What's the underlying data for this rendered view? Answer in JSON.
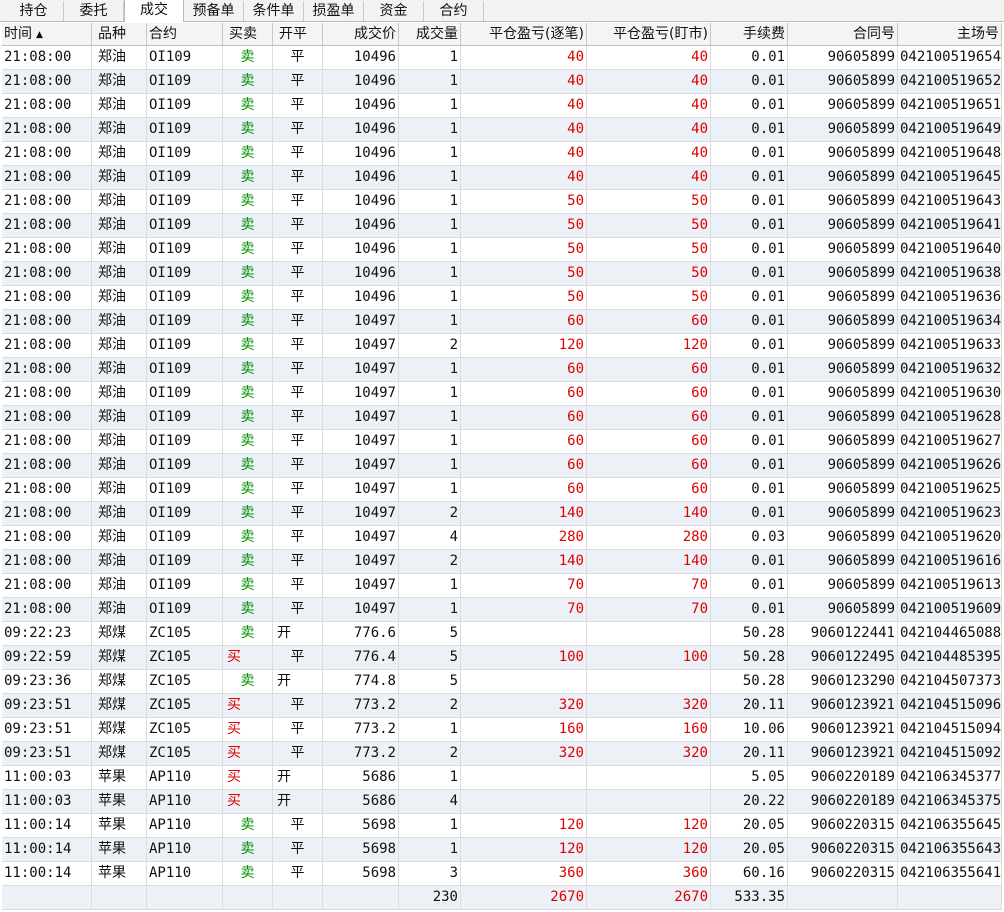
{
  "tabs": [
    "持仓",
    "委托",
    "成交",
    "预备单",
    "条件单",
    "损盈单",
    "资金",
    "合约"
  ],
  "active_tab": 2,
  "columns": {
    "time": "时间",
    "product": "品种",
    "contract": "合约",
    "side": "买卖",
    "openclose": "开平",
    "price": "成交价",
    "qty": "成交量",
    "pnl_trade": "平仓盈亏(逐笔)",
    "pnl_mtm": "平仓盈亏(盯市)",
    "fee": "手续费",
    "contract_no": "合同号",
    "exchange_no": "主场号"
  },
  "sort_icon": "sort-ascending-icon",
  "rows": [
    {
      "time": "21:08:00",
      "product": "郑油",
      "contract": "OI109",
      "side": "卖",
      "oc": "平",
      "price": "10496",
      "qty": "1",
      "pnl1": "40",
      "pnl2": "40",
      "fee": "0.01",
      "cno": "90605899",
      "exno": "042100519654"
    },
    {
      "time": "21:08:00",
      "product": "郑油",
      "contract": "OI109",
      "side": "卖",
      "oc": "平",
      "price": "10496",
      "qty": "1",
      "pnl1": "40",
      "pnl2": "40",
      "fee": "0.01",
      "cno": "90605899",
      "exno": "042100519652"
    },
    {
      "time": "21:08:00",
      "product": "郑油",
      "contract": "OI109",
      "side": "卖",
      "oc": "平",
      "price": "10496",
      "qty": "1",
      "pnl1": "40",
      "pnl2": "40",
      "fee": "0.01",
      "cno": "90605899",
      "exno": "042100519651"
    },
    {
      "time": "21:08:00",
      "product": "郑油",
      "contract": "OI109",
      "side": "卖",
      "oc": "平",
      "price": "10496",
      "qty": "1",
      "pnl1": "40",
      "pnl2": "40",
      "fee": "0.01",
      "cno": "90605899",
      "exno": "042100519649"
    },
    {
      "time": "21:08:00",
      "product": "郑油",
      "contract": "OI109",
      "side": "卖",
      "oc": "平",
      "price": "10496",
      "qty": "1",
      "pnl1": "40",
      "pnl2": "40",
      "fee": "0.01",
      "cno": "90605899",
      "exno": "042100519648"
    },
    {
      "time": "21:08:00",
      "product": "郑油",
      "contract": "OI109",
      "side": "卖",
      "oc": "平",
      "price": "10496",
      "qty": "1",
      "pnl1": "40",
      "pnl2": "40",
      "fee": "0.01",
      "cno": "90605899",
      "exno": "042100519645"
    },
    {
      "time": "21:08:00",
      "product": "郑油",
      "contract": "OI109",
      "side": "卖",
      "oc": "平",
      "price": "10496",
      "qty": "1",
      "pnl1": "50",
      "pnl2": "50",
      "fee": "0.01",
      "cno": "90605899",
      "exno": "042100519643"
    },
    {
      "time": "21:08:00",
      "product": "郑油",
      "contract": "OI109",
      "side": "卖",
      "oc": "平",
      "price": "10496",
      "qty": "1",
      "pnl1": "50",
      "pnl2": "50",
      "fee": "0.01",
      "cno": "90605899",
      "exno": "042100519641"
    },
    {
      "time": "21:08:00",
      "product": "郑油",
      "contract": "OI109",
      "side": "卖",
      "oc": "平",
      "price": "10496",
      "qty": "1",
      "pnl1": "50",
      "pnl2": "50",
      "fee": "0.01",
      "cno": "90605899",
      "exno": "042100519640"
    },
    {
      "time": "21:08:00",
      "product": "郑油",
      "contract": "OI109",
      "side": "卖",
      "oc": "平",
      "price": "10496",
      "qty": "1",
      "pnl1": "50",
      "pnl2": "50",
      "fee": "0.01",
      "cno": "90605899",
      "exno": "042100519638"
    },
    {
      "time": "21:08:00",
      "product": "郑油",
      "contract": "OI109",
      "side": "卖",
      "oc": "平",
      "price": "10496",
      "qty": "1",
      "pnl1": "50",
      "pnl2": "50",
      "fee": "0.01",
      "cno": "90605899",
      "exno": "042100519636"
    },
    {
      "time": "21:08:00",
      "product": "郑油",
      "contract": "OI109",
      "side": "卖",
      "oc": "平",
      "price": "10497",
      "qty": "1",
      "pnl1": "60",
      "pnl2": "60",
      "fee": "0.01",
      "cno": "90605899",
      "exno": "042100519634"
    },
    {
      "time": "21:08:00",
      "product": "郑油",
      "contract": "OI109",
      "side": "卖",
      "oc": "平",
      "price": "10497",
      "qty": "2",
      "pnl1": "120",
      "pnl2": "120",
      "fee": "0.01",
      "cno": "90605899",
      "exno": "042100519633"
    },
    {
      "time": "21:08:00",
      "product": "郑油",
      "contract": "OI109",
      "side": "卖",
      "oc": "平",
      "price": "10497",
      "qty": "1",
      "pnl1": "60",
      "pnl2": "60",
      "fee": "0.01",
      "cno": "90605899",
      "exno": "042100519632"
    },
    {
      "time": "21:08:00",
      "product": "郑油",
      "contract": "OI109",
      "side": "卖",
      "oc": "平",
      "price": "10497",
      "qty": "1",
      "pnl1": "60",
      "pnl2": "60",
      "fee": "0.01",
      "cno": "90605899",
      "exno": "042100519630"
    },
    {
      "time": "21:08:00",
      "product": "郑油",
      "contract": "OI109",
      "side": "卖",
      "oc": "平",
      "price": "10497",
      "qty": "1",
      "pnl1": "60",
      "pnl2": "60",
      "fee": "0.01",
      "cno": "90605899",
      "exno": "042100519628"
    },
    {
      "time": "21:08:00",
      "product": "郑油",
      "contract": "OI109",
      "side": "卖",
      "oc": "平",
      "price": "10497",
      "qty": "1",
      "pnl1": "60",
      "pnl2": "60",
      "fee": "0.01",
      "cno": "90605899",
      "exno": "042100519627"
    },
    {
      "time": "21:08:00",
      "product": "郑油",
      "contract": "OI109",
      "side": "卖",
      "oc": "平",
      "price": "10497",
      "qty": "1",
      "pnl1": "60",
      "pnl2": "60",
      "fee": "0.01",
      "cno": "90605899",
      "exno": "042100519626"
    },
    {
      "time": "21:08:00",
      "product": "郑油",
      "contract": "OI109",
      "side": "卖",
      "oc": "平",
      "price": "10497",
      "qty": "1",
      "pnl1": "60",
      "pnl2": "60",
      "fee": "0.01",
      "cno": "90605899",
      "exno": "042100519625"
    },
    {
      "time": "21:08:00",
      "product": "郑油",
      "contract": "OI109",
      "side": "卖",
      "oc": "平",
      "price": "10497",
      "qty": "2",
      "pnl1": "140",
      "pnl2": "140",
      "fee": "0.01",
      "cno": "90605899",
      "exno": "042100519623"
    },
    {
      "time": "21:08:00",
      "product": "郑油",
      "contract": "OI109",
      "side": "卖",
      "oc": "平",
      "price": "10497",
      "qty": "4",
      "pnl1": "280",
      "pnl2": "280",
      "fee": "0.03",
      "cno": "90605899",
      "exno": "042100519620"
    },
    {
      "time": "21:08:00",
      "product": "郑油",
      "contract": "OI109",
      "side": "卖",
      "oc": "平",
      "price": "10497",
      "qty": "2",
      "pnl1": "140",
      "pnl2": "140",
      "fee": "0.01",
      "cno": "90605899",
      "exno": "042100519616"
    },
    {
      "time": "21:08:00",
      "product": "郑油",
      "contract": "OI109",
      "side": "卖",
      "oc": "平",
      "price": "10497",
      "qty": "1",
      "pnl1": "70",
      "pnl2": "70",
      "fee": "0.01",
      "cno": "90605899",
      "exno": "042100519613"
    },
    {
      "time": "21:08:00",
      "product": "郑油",
      "contract": "OI109",
      "side": "卖",
      "oc": "平",
      "price": "10497",
      "qty": "1",
      "pnl1": "70",
      "pnl2": "70",
      "fee": "0.01",
      "cno": "90605899",
      "exno": "042100519609"
    },
    {
      "time": "09:22:23",
      "product": "郑煤",
      "contract": "ZC105",
      "side": "卖",
      "oc": "开",
      "price": "776.6",
      "qty": "5",
      "pnl1": "",
      "pnl2": "",
      "fee": "50.28",
      "cno": "9060122441",
      "exno": "042104465088"
    },
    {
      "time": "09:22:59",
      "product": "郑煤",
      "contract": "ZC105",
      "side": "买",
      "oc": "平",
      "price": "776.4",
      "qty": "5",
      "pnl1": "100",
      "pnl2": "100",
      "fee": "50.28",
      "cno": "9060122495",
      "exno": "042104485395"
    },
    {
      "time": "09:23:36",
      "product": "郑煤",
      "contract": "ZC105",
      "side": "卖",
      "oc": "开",
      "price": "774.8",
      "qty": "5",
      "pnl1": "",
      "pnl2": "",
      "fee": "50.28",
      "cno": "9060123290",
      "exno": "042104507373"
    },
    {
      "time": "09:23:51",
      "product": "郑煤",
      "contract": "ZC105",
      "side": "买",
      "oc": "平",
      "price": "773.2",
      "qty": "2",
      "pnl1": "320",
      "pnl2": "320",
      "fee": "20.11",
      "cno": "9060123921",
      "exno": "042104515096"
    },
    {
      "time": "09:23:51",
      "product": "郑煤",
      "contract": "ZC105",
      "side": "买",
      "oc": "平",
      "price": "773.2",
      "qty": "1",
      "pnl1": "160",
      "pnl2": "160",
      "fee": "10.06",
      "cno": "9060123921",
      "exno": "042104515094"
    },
    {
      "time": "09:23:51",
      "product": "郑煤",
      "contract": "ZC105",
      "side": "买",
      "oc": "平",
      "price": "773.2",
      "qty": "2",
      "pnl1": "320",
      "pnl2": "320",
      "fee": "20.11",
      "cno": "9060123921",
      "exno": "042104515092"
    },
    {
      "time": "11:00:03",
      "product": "苹果",
      "contract": "AP110",
      "side": "买",
      "oc": "开",
      "price": "5686",
      "qty": "1",
      "pnl1": "",
      "pnl2": "",
      "fee": "5.05",
      "cno": "9060220189",
      "exno": "042106345377"
    },
    {
      "time": "11:00:03",
      "product": "苹果",
      "contract": "AP110",
      "side": "买",
      "oc": "开",
      "price": "5686",
      "qty": "4",
      "pnl1": "",
      "pnl2": "",
      "fee": "20.22",
      "cno": "9060220189",
      "exno": "042106345375"
    },
    {
      "time": "11:00:14",
      "product": "苹果",
      "contract": "AP110",
      "side": "卖",
      "oc": "平",
      "price": "5698",
      "qty": "1",
      "pnl1": "120",
      "pnl2": "120",
      "fee": "20.05",
      "cno": "9060220315",
      "exno": "042106355645"
    },
    {
      "time": "11:00:14",
      "product": "苹果",
      "contract": "AP110",
      "side": "卖",
      "oc": "平",
      "price": "5698",
      "qty": "1",
      "pnl1": "120",
      "pnl2": "120",
      "fee": "20.05",
      "cno": "9060220315",
      "exno": "042106355643"
    },
    {
      "time": "11:00:14",
      "product": "苹果",
      "contract": "AP110",
      "side": "卖",
      "oc": "平",
      "price": "5698",
      "qty": "3",
      "pnl1": "360",
      "pnl2": "360",
      "fee": "60.16",
      "cno": "9060220315",
      "exno": "042106355641"
    }
  ],
  "totals": {
    "qty": "230",
    "pnl1": "2670",
    "pnl2": "2670",
    "fee": "533.35"
  },
  "colors": {
    "buy": "#e00000",
    "sell": "#009000",
    "pnl": "#e00000"
  }
}
